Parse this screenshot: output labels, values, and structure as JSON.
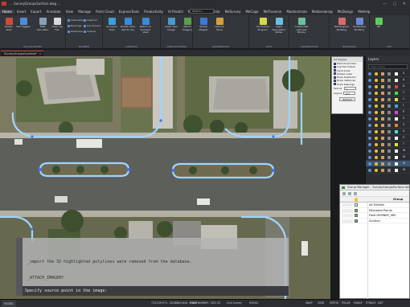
{
  "window": {
    "title": "... SurveyGroupsSurface.dwg ..."
  },
  "menu_tabs": [
    "Home",
    "Insert",
    "Export",
    "Annotate",
    "View",
    "Manage",
    "Point Cloud",
    "ExpressTools",
    "Productivity",
    "AI Predict",
    "MeTools",
    "MePoints",
    "MeSurvey",
    "MeCogo",
    "MeTraverse",
    "Masterstrate",
    "Mekbreaking",
    "MeDesign",
    "MeHelp"
  ],
  "menu_active": "Home",
  "search_placeholder": "Search...",
  "ribbon": {
    "buttons": [
      {
        "label": "Raster Tools",
        "icon": "raster-icon",
        "color": "#d04a3a"
      },
      {
        "label": "Hot Toggles",
        "icon": "toggle-icon",
        "color": "#4a8ed8"
      },
      {
        "label": "RPN Calculator",
        "icon": "calculator-icon",
        "color": "#8aa0b8"
      },
      {
        "label": "View Log File",
        "icon": "log-icon",
        "color": "#d8d8d8"
      },
      {
        "label": "Surveyor View",
        "icon": "surveyor-icon",
        "color": "#3aa0d8"
      },
      {
        "label": "Rotate View (North Up)",
        "icon": "rotate-icon",
        "color": "#3a8ad8"
      },
      {
        "label": "Return to Surveyor View",
        "icon": "return-icon",
        "color": "#3a8ad8"
      },
      {
        "label": "Insert Geo Image",
        "icon": "geo-image-icon",
        "color": "#4a9ad0"
      },
      {
        "label": "Attach Imagery",
        "icon": "imagery-icon",
        "color": "#5aa04a"
      },
      {
        "label": "Global Mapper",
        "icon": "globe-icon",
        "color": "#3a7ad8"
      },
      {
        "label": "Vertical Store",
        "icon": "store-icon",
        "color": "#d8a03a"
      },
      {
        "label": "Lot Closure Program",
        "icon": "lot-closure-icon",
        "color": "#d8d84a"
      },
      {
        "label": "Legal Description Writer",
        "icon": "legal-icon",
        "color": "#6ac0e0"
      },
      {
        "label": "Create Edit Lots and Blocks",
        "icon": "lots-icon",
        "color": "#6ac0a0"
      },
      {
        "label": "Rectangular Building",
        "icon": "building-icon",
        "color": "#d86a6a"
      },
      {
        "label": "Multisided Building",
        "icon": "multi-building-icon",
        "color": "#6a8ad8"
      },
      {
        "label": "Eff",
        "icon": "eff-icon",
        "color": "#5ad05a"
      }
    ],
    "small_items": [
      "Calculations",
      "Bearings",
      "Distances",
      "Insert on",
      "Lot Closure",
      "Inverse"
    ],
    "groups": [
      "CALCULATIONS",
      "NUMBER",
      "LABELING",
      "VIEW ROTATION",
      "GEOSERVICES",
      "LOTS",
      "TRANSECTION",
      "BUILDINGS",
      "ETC"
    ]
  },
  "document_tab": "SurveyGroupsSurface*",
  "properties_panel": {
    "title": "Alt Toggles",
    "options": [
      {
        "label": "Point Production",
        "checked": true
      },
      {
        "label": "Log File Output",
        "checked": true
      },
      {
        "label": "Input scale",
        "checked": true
      },
      {
        "label": "Output scale",
        "checked": true
      },
      {
        "label": "Draw lineblocks",
        "checked": true
      },
      {
        "label": "Draw distances",
        "checked": true
      },
      {
        "label": "Draw bearings",
        "checked": true
      }
    ],
    "fields": [
      {
        "label": "Text pt.",
        "value": "1"
      },
      {
        "label": "Layout",
        "value": "127"
      }
    ],
    "refresh_label": "Refresh"
  },
  "layers_panel": {
    "title": "Layers",
    "search_placeholder": "Layer name",
    "rows": [
      {
        "name": "0",
        "color": "#ffffff",
        "selected": false
      },
      {
        "name": "A",
        "color": "#ffffff",
        "selected": false
      },
      {
        "name": "B",
        "color": "#e04040",
        "selected": false
      },
      {
        "name": "C",
        "color": "#40e040",
        "selected": false
      },
      {
        "name": "C",
        "color": "#e0e040",
        "selected": false
      },
      {
        "name": "L",
        "color": "#40a0e0",
        "selected": false
      },
      {
        "name": "P",
        "color": "#e040e0",
        "selected": false
      },
      {
        "name": "S",
        "color": "#ffffff",
        "selected": false
      },
      {
        "name": "S",
        "color": "#e08040",
        "selected": false
      },
      {
        "name": "S",
        "color": "#40e0e0",
        "selected": false
      },
      {
        "name": "S",
        "color": "#ffffff",
        "selected": false
      },
      {
        "name": "T",
        "color": "#e0e040",
        "selected": false
      },
      {
        "name": "W",
        "color": "#ffffff",
        "selected": false
      },
      {
        "name": "W",
        "color": "#ffffff",
        "selected": false
      },
      {
        "name": "W",
        "color": "#ffffff",
        "selected": true
      },
      {
        "name": "W",
        "color": "#ffffff",
        "selected": false
      }
    ]
  },
  "group_manager": {
    "title": "Group Manager - SurveyGroupsSurface.dw",
    "column_header": "Group",
    "rows": [
      {
        "name": "All Entities",
        "checked": false
      },
      {
        "name": "Miscoded Points",
        "checked": true
      },
      {
        "name": "Field DEMNNY_MM",
        "checked": true
      },
      {
        "name": "Surface",
        "checked": true
      }
    ]
  },
  "command_line": {
    "history": [
      "_import the 32 highlighted polylines were removed from the database.",
      "_ATTACH_IMAGERY"
    ],
    "prompt": "Specify source point in the image:"
  },
  "status_bar": {
    "coordinates": "712139.971, 2618884.643, 0.000",
    "items": [
      "POINTNUMBER",
      "GEO ZS",
      "Grid Survey",
      "MODEL"
    ],
    "right_items": [
      "SNAP",
      "GRID",
      "ORTHO",
      "POLAR",
      "ESNAP",
      "ETRACK",
      "LWT"
    ],
    "model_tab": "MODEL"
  }
}
